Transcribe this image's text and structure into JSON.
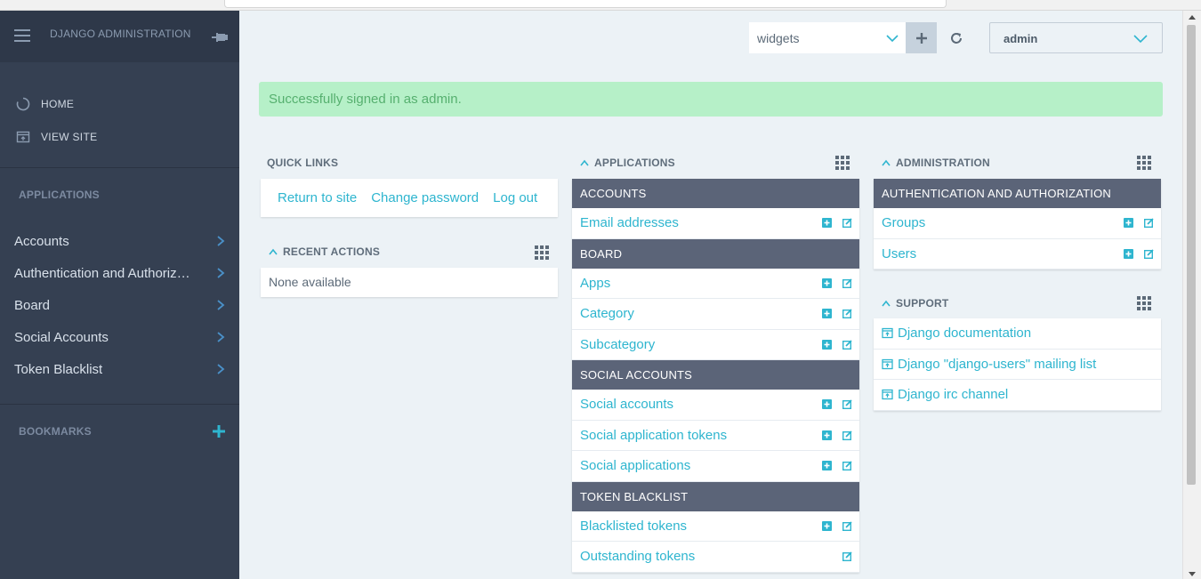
{
  "sidebar": {
    "brand": "DJANGO ADMINISTRATION",
    "top_links": [
      {
        "label": "HOME",
        "icon": "home-icon"
      },
      {
        "label": "VIEW SITE",
        "icon": "view-site-icon"
      }
    ],
    "applications_title": "APPLICATIONS",
    "apps": [
      "Accounts",
      "Authentication and Authoriz…",
      "Board",
      "Social Accounts",
      "Token Blacklist"
    ],
    "bookmarks_title": "BOOKMARKS"
  },
  "topbar": {
    "widgets_select": "widgets",
    "user_select": "admin"
  },
  "message": "Successfully signed in as admin.",
  "quick_links": {
    "title": "QUICK LINKS",
    "links": [
      "Return to site",
      "Change password",
      "Log out"
    ]
  },
  "recent_actions": {
    "title": "RECENT ACTIONS",
    "empty": "None available"
  },
  "applications": {
    "title": "APPLICATIONS",
    "modules": [
      {
        "name": "ACCOUNTS",
        "models": [
          "Email addresses"
        ]
      },
      {
        "name": "BOARD",
        "models": [
          "Apps",
          "Category",
          "Subcategory"
        ]
      },
      {
        "name": "SOCIAL ACCOUNTS",
        "models": [
          "Social accounts",
          "Social application tokens",
          "Social applications"
        ]
      },
      {
        "name": "TOKEN BLACKLIST",
        "models": [
          "Blacklisted tokens",
          "Outstanding tokens"
        ]
      }
    ]
  },
  "administration": {
    "title": "ADMINISTRATION",
    "module": "AUTHENTICATION AND AUTHORIZATION",
    "models": [
      "Groups",
      "Users"
    ]
  },
  "support": {
    "title": "SUPPORT",
    "links": [
      "Django documentation",
      "Django \"django-users\" mailing list",
      "Django irc channel"
    ]
  },
  "colors": {
    "sidebar_bg": "#354052",
    "module_header": "#5b6478",
    "link": "#2eb5cf",
    "success_bg": "#b6f0c8",
    "page_bg": "#ecf2f6"
  }
}
